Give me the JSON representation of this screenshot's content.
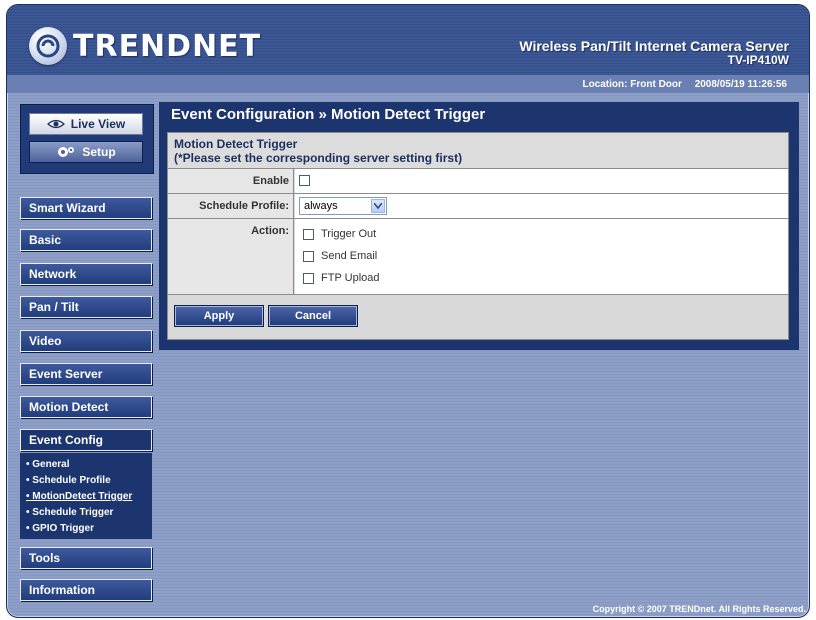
{
  "brand": {
    "logo_text": "TRENDNET"
  },
  "header": {
    "product": "Wireless Pan/Tilt Internet Camera Server",
    "model": "TV-IP410W",
    "location": "Location: Front Door",
    "datetime": "2008/05/19 11:26:56"
  },
  "view_buttons": {
    "live_view": "Live View",
    "setup": "Setup"
  },
  "menu": {
    "smart_wizard": "Smart Wizard",
    "basic": "Basic",
    "network": "Network",
    "pan_tilt": "Pan / Tilt",
    "video": "Video",
    "event_server": "Event Server",
    "motion_detect": "Motion Detect",
    "event_config": "Event Config",
    "tools": "Tools",
    "information": "Information"
  },
  "submenu": [
    "• General",
    "• Schedule Profile",
    "• MotionDetect Trigger",
    "• Schedule Trigger",
    "• GPIO Trigger"
  ],
  "page": {
    "title": "Event Configuration » Motion Detect Trigger",
    "section_title": "Motion Detect Trigger",
    "section_note": "(*Please set the corresponding server setting first)"
  },
  "form": {
    "enable_label": "Enable",
    "schedule_label": "Schedule Profile:",
    "schedule_value": "always",
    "action_label": "Action:",
    "actions": [
      "Trigger Out",
      "Send Email",
      "FTP Upload"
    ]
  },
  "buttons": {
    "apply": "Apply",
    "cancel": "Cancel"
  },
  "footer": "Copyright © 2007 TRENDnet. All Rights Reserved."
}
